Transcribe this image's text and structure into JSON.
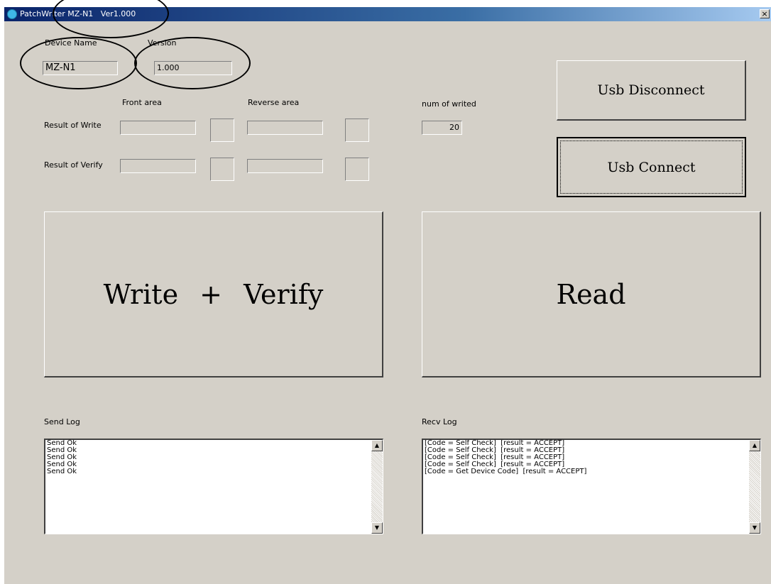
{
  "window": {
    "title": "PatchWriter MZ-N1   Ver1.000",
    "close_label": "×",
    "app_icon": "patchwriter-app-icon"
  },
  "device": {
    "name_label": "Device Name",
    "name_value": "MZ-N1",
    "version_label": "Version",
    "version_value": "1.000"
  },
  "results": {
    "front_area_label": "Front area",
    "reverse_area_label": "Reverse area",
    "write_label": "Result of Write",
    "verify_label": "Result of Verify",
    "write_front_value": "",
    "write_reverse_value": "",
    "verify_front_value": "",
    "verify_reverse_value": ""
  },
  "counter": {
    "label": "num of writed",
    "value": "20"
  },
  "buttons": {
    "usb_disconnect": "Usb Disconnect",
    "usb_connect": "Usb Connect",
    "write_verify": "Write + Verify",
    "read": "Read"
  },
  "send_log": {
    "label": "Send Log",
    "lines": [
      "Send Ok",
      "Send Ok",
      "Send Ok",
      "Send Ok",
      "Send Ok"
    ]
  },
  "recv_log": {
    "label": "Recv Log",
    "lines": [
      "[Code = Self Check]  [result = ACCEPT]",
      "[Code = Self Check]  [result = ACCEPT]",
      "[Code = Self Check]  [result = ACCEPT]",
      "[Code = Self Check]  [result = ACCEPT]",
      "[Code = Get Device Code]  [result = ACCEPT]"
    ]
  },
  "scrollbar": {
    "up_arrow": "▲",
    "down_arrow": "▼"
  }
}
